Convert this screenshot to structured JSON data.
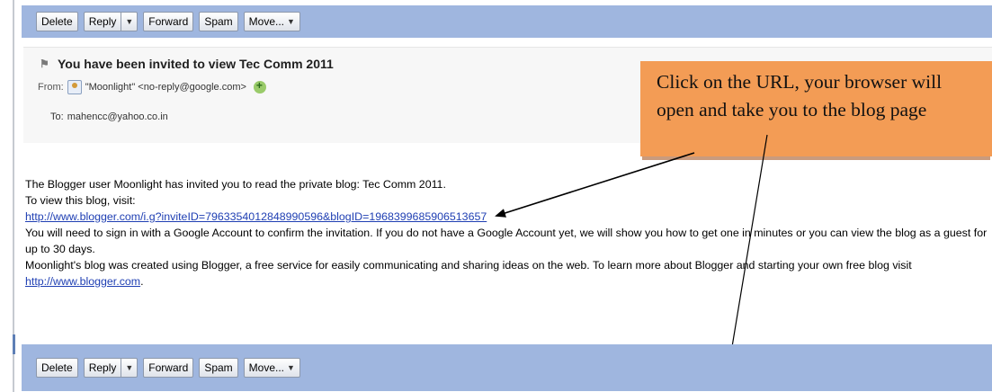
{
  "toolbar": {
    "delete_label": "Delete",
    "reply_label": "Reply",
    "forward_label": "Forward",
    "spam_label": "Spam",
    "move_label": "Move..."
  },
  "message": {
    "subject": "You have been invited to view Tec Comm 2011",
    "from_label": "From:",
    "from_sender": "\"Moonlight\" <no-reply@google.com>",
    "to_label": "To:",
    "to_address": "mahencc@yahoo.co.in"
  },
  "body": {
    "line1": "The Blogger user Moonlight has invited you to read the private blog: Tec Comm 2011.",
    "line2": "To view this blog, visit:",
    "invite_link": "http://www.blogger.com/i.g?inviteID=7963354012848990596&blogID=1968399685906513657",
    "line3": "You will need to sign in with a Google Account to confirm the invitation. If you do not have a Google Account yet, we will show you how to get one in minutes or you can view the blog as a guest for up to 30 days.",
    "line4": "Moonlight's blog was created using Blogger, a free service for easily communicating and sharing ideas on the web. To learn more about Blogger and starting your own free blog visit",
    "blogger_link": "http://www.blogger.com",
    "blogger_link_suffix": "."
  },
  "callout": {
    "line1": "Click on the URL, your browser will",
    "line2": "open and take you to the blog page"
  },
  "colors": {
    "toolbar_bg": "#9fb6df",
    "callout_bg": "#f39c55",
    "link": "#1f3fb3"
  },
  "icons": {
    "flag": "flag-icon",
    "contact": "contact-icon",
    "add_contact": "add-contact-icon",
    "dropdown": "chevron-down-icon"
  }
}
